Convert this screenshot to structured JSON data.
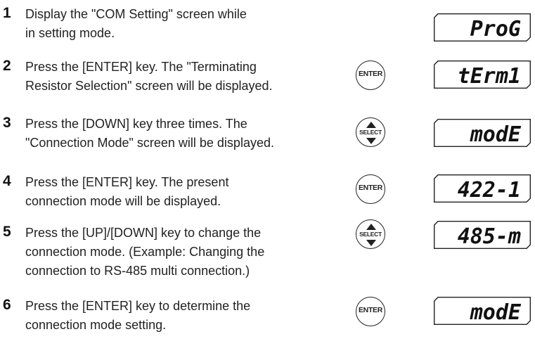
{
  "steps": [
    {
      "number": "1",
      "lines": [
        "Display the \"COM Setting\" screen while",
        "in setting mode."
      ],
      "key": "",
      "display": "ProG"
    },
    {
      "number": "2",
      "lines": [
        "Press the [ENTER] key. The \"Terminating",
        "Resistor Selection\" screen will be displayed."
      ],
      "key": "ENTER",
      "display": "tErm1"
    },
    {
      "number": "3",
      "lines": [
        "Press the [DOWN] key three times. The",
        "\"Connection Mode\" screen will be displayed."
      ],
      "key": "SELECT",
      "display": "modE"
    },
    {
      "number": "4",
      "lines": [
        "Press the [ENTER] key. The present",
        "connection mode will be displayed."
      ],
      "key": "ENTER",
      "display": "422-1"
    },
    {
      "number": "5",
      "lines": [
        "Press the [UP]/[DOWN] key to change the",
        "connection mode. (Example: Changing the",
        "connection to RS-485 multi connection.)"
      ],
      "key": "SELECT",
      "display": "485-m"
    },
    {
      "number": "6",
      "lines": [
        "Press the [ENTER] key to determine the",
        "connection mode setting."
      ],
      "key": "ENTER",
      "display": "modE"
    }
  ]
}
